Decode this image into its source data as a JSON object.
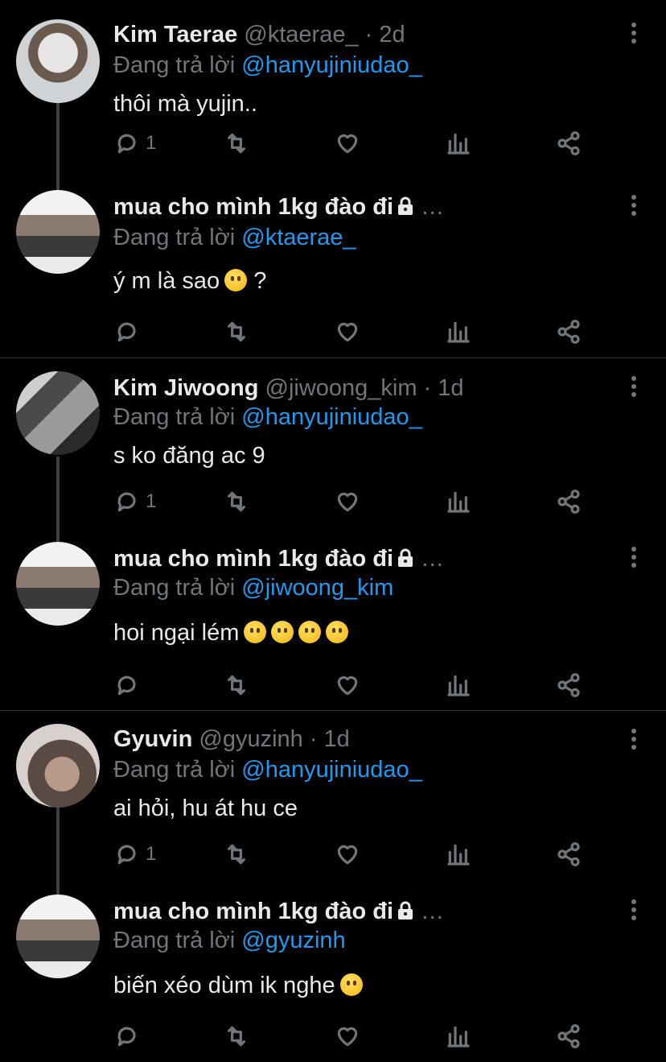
{
  "colors": {
    "background": "#000000",
    "text": "#e7e9ea",
    "muted": "#71767b",
    "accent": "#1d9bf0",
    "divider": "#2f3336"
  },
  "tweets": [
    {
      "name": "Kim Taerae",
      "handle": "@ktaerae_",
      "time": "· 2d",
      "replying_label": "Đang trả lời",
      "mention": "@hanyujiniudao_",
      "text": "thôi mà yujin..",
      "reply_count": "1",
      "avatar": "avatar-photo-1"
    },
    {
      "name": "mua cho mình 1kg đào đi",
      "handle": "…",
      "time": "",
      "replying_label": "Đang trả lời",
      "mention": "@ktaerae_",
      "text": "ý m là sao",
      "text_suffix": "?",
      "reply_count": "",
      "avatar": "avatar-photo-2"
    },
    {
      "name": "Kim Jiwoong",
      "handle": "@jiwoong_kim",
      "time": "· 1d",
      "replying_label": "Đang trả lời",
      "mention": "@hanyujiniudao_",
      "text": "s ko đăng ac 9",
      "reply_count": "1",
      "avatar": "avatar-photo-3"
    },
    {
      "name": "mua cho mình 1kg đào đi",
      "handle": "…",
      "time": "",
      "replying_label": "Đang trả lời",
      "mention": "@jiwoong_kim",
      "text": "hoi ngại lém",
      "reply_count": "",
      "avatar": "avatar-photo-2"
    },
    {
      "name": "Gyuvin",
      "handle": "@gyuzinh",
      "time": "· 1d",
      "replying_label": "Đang trả lời",
      "mention": "@hanyujiniudao_",
      "text": "ai hỏi, hu át hu ce",
      "reply_count": "1",
      "avatar": "avatar-photo-4"
    },
    {
      "name": "mua cho mình 1kg đào đi",
      "handle": "…",
      "time": "",
      "replying_label": "Đang trả lời",
      "mention": "@gyuzinh",
      "text": "biến xéo dùm ik nghe",
      "reply_count": "",
      "avatar": "avatar-photo-2"
    }
  ],
  "icons": {
    "reply": "reply-icon",
    "retweet": "retweet-icon",
    "like": "heart-icon",
    "views": "analytics-icon",
    "share": "share-icon",
    "more": "more-icon",
    "lock": "lock-icon"
  }
}
